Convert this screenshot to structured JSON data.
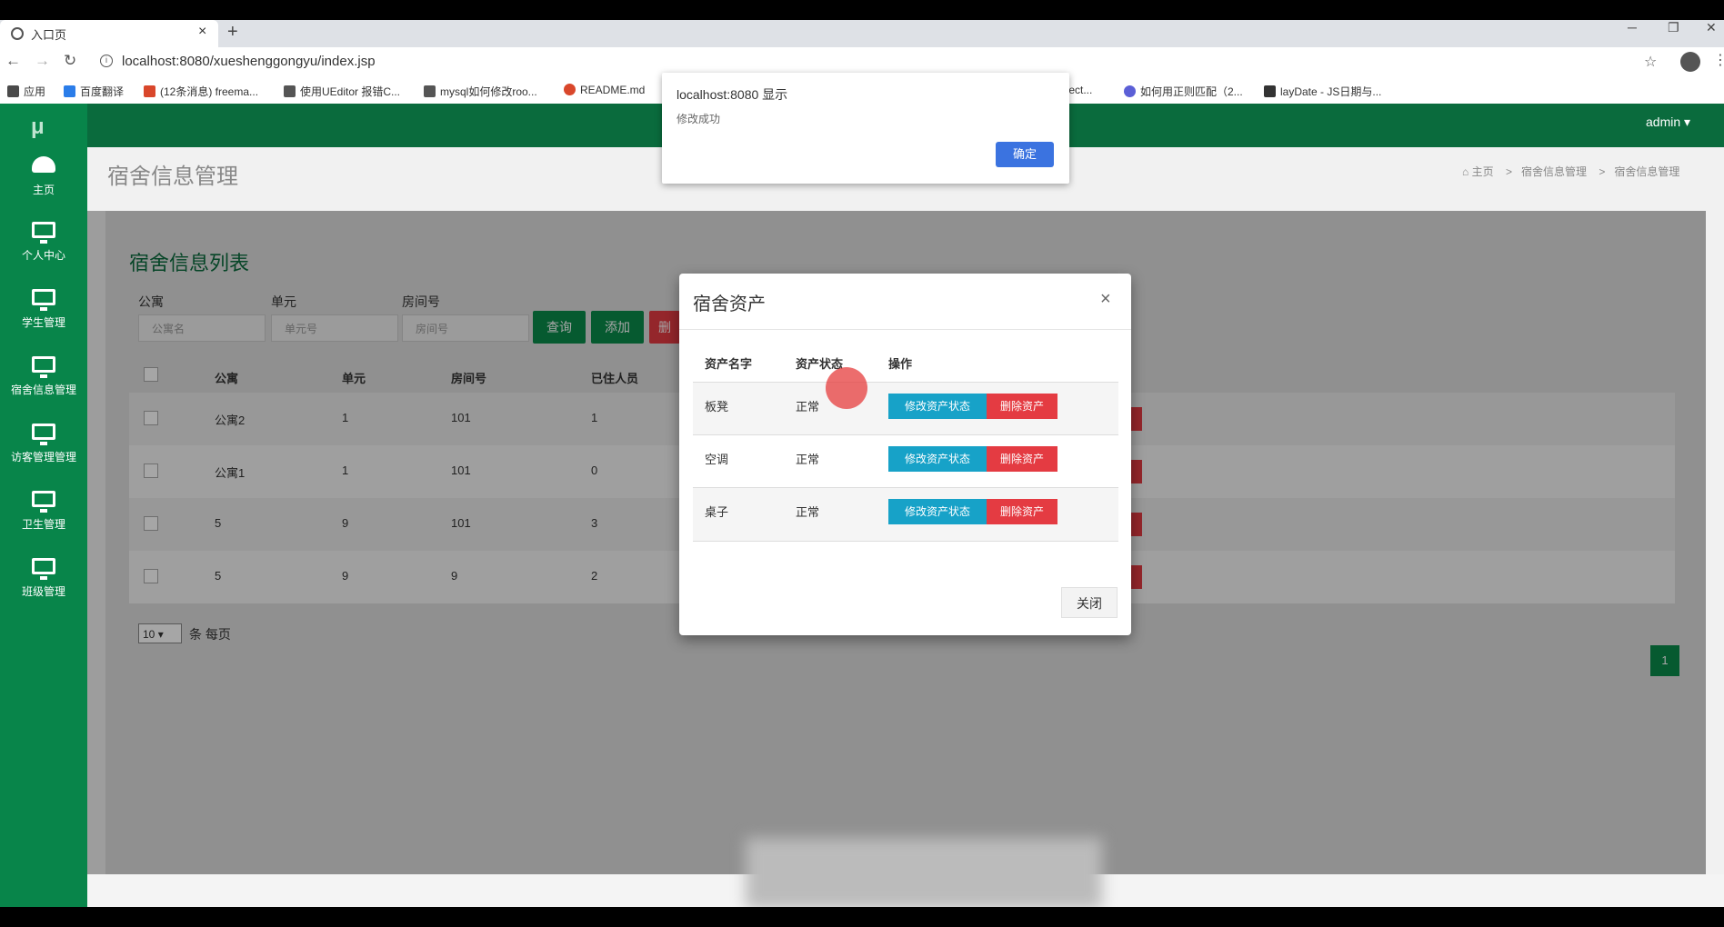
{
  "browser": {
    "tab_title": "入口页",
    "new_tab": "+",
    "window_controls": [
      "─",
      "❐",
      "✕"
    ],
    "url": "localhost:8080/xueshenggongyu/index.jsp",
    "bookmarks": [
      {
        "label": "应用",
        "color": "#4a4a4a"
      },
      {
        "label": "百度翻译",
        "color": "#2b7de9"
      },
      {
        "label": "(12条消息) freema...",
        "color": "#d9472b"
      },
      {
        "label": "使用UEditor 报错C...",
        "color": "#555555"
      },
      {
        "label": "mysql如何修改roo...",
        "color": "#555555"
      },
      {
        "label": "README.md",
        "color": "#d9472b"
      },
      {
        "label": "elect...",
        "color": "#777777"
      },
      {
        "label": "如何用正则匹配（2...",
        "color": "#5b5fd6"
      },
      {
        "label": "layDate - JS日期与...",
        "color": "#333333"
      }
    ]
  },
  "header": {
    "user": "admin ▾"
  },
  "sidebar": {
    "logo": "μ",
    "items": [
      {
        "label": "主页",
        "icon": "dashboard-icon"
      },
      {
        "label": "个人中心",
        "icon": "monitor-icon"
      },
      {
        "label": "学生管理",
        "icon": "monitor-icon"
      },
      {
        "label": "宿舍信息管理",
        "icon": "monitor-icon"
      },
      {
        "label": "访客管理管理",
        "icon": "monitor-icon"
      },
      {
        "label": "卫生管理",
        "icon": "monitor-icon"
      },
      {
        "label": "班级管理",
        "icon": "monitor-icon"
      }
    ]
  },
  "page": {
    "title": "宿舍信息管理",
    "breadcrumb": [
      "主页",
      "宿舍信息管理",
      "宿舍信息管理"
    ]
  },
  "list": {
    "title": "宿舍信息列表",
    "filters": [
      {
        "label": "公寓",
        "placeholder": "公寓名"
      },
      {
        "label": "单元",
        "placeholder": "单元号"
      },
      {
        "label": "房间号",
        "placeholder": "房间号"
      }
    ],
    "buttons": {
      "search": "查询",
      "add": "添加",
      "delete": "删"
    },
    "columns": [
      "公寓",
      "单元",
      "房间号",
      "已住人员"
    ],
    "rows": [
      [
        "公寓2",
        "1",
        "101",
        "1"
      ],
      [
        "公寓1",
        "1",
        "101",
        "0"
      ],
      [
        "5",
        "9",
        "101",
        "3"
      ],
      [
        "5",
        "9",
        "9",
        "2"
      ]
    ],
    "page_size": "10",
    "page_size_suffix": "条 每页",
    "current_page": "1"
  },
  "modal": {
    "title": "宿舍资产",
    "close_icon": "×",
    "columns": [
      "资产名字",
      "资产状态",
      "操作"
    ],
    "rows": [
      {
        "name": "板凳",
        "status": "正常"
      },
      {
        "name": "空调",
        "status": "正常"
      },
      {
        "name": "桌子",
        "status": "正常"
      }
    ],
    "edit_label": "修改资产状态",
    "delete_label": "删除资产",
    "close_label": "关闭"
  },
  "alert": {
    "title": "localhost:8080 显示",
    "message": "修改成功",
    "ok": "确定"
  }
}
